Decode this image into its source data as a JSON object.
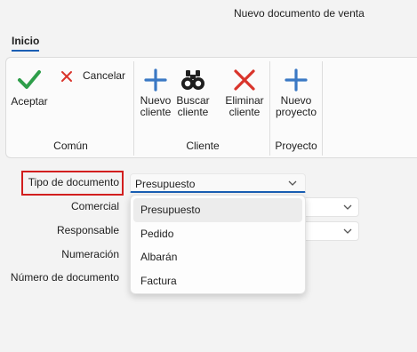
{
  "window": {
    "title": "Nuevo documento de venta"
  },
  "ribbon": {
    "tab": "Inicio",
    "groups": [
      {
        "label": "Común"
      },
      {
        "label": "Cliente"
      },
      {
        "label": "Proyecto"
      }
    ],
    "buttons": {
      "accept": "Aceptar",
      "cancel": "Cancelar",
      "new_client": "Nuevo\ncliente",
      "search_client": "Buscar\ncliente",
      "delete_client": "Eliminar\ncliente",
      "new_project": "Nuevo\nproyecto"
    },
    "icons": {
      "accept": "checkmark-icon",
      "cancel": "x-icon",
      "new_client": "plus-icon",
      "search_client": "binoculars-icon",
      "delete_client": "x-icon",
      "new_project": "plus-icon"
    }
  },
  "form": {
    "fields": [
      {
        "label": "Tipo de documento",
        "value": "Presupuesto"
      },
      {
        "label": "Comercial",
        "value": ""
      },
      {
        "label": "Responsable",
        "value": ""
      },
      {
        "label": "Numeración",
        "value": ""
      },
      {
        "label": "Número de documento",
        "value": ""
      }
    ]
  },
  "dropdown": {
    "options": [
      "Presupuesto",
      "Pedido",
      "Albarán",
      "Factura"
    ],
    "selected": "Presupuesto"
  },
  "colors": {
    "accent": "#1a5fb4",
    "check_green": "#2e9e4a",
    "cancel_red": "#d9342b",
    "plus_blue": "#3a78c4",
    "highlight_red": "#d21e1e"
  }
}
